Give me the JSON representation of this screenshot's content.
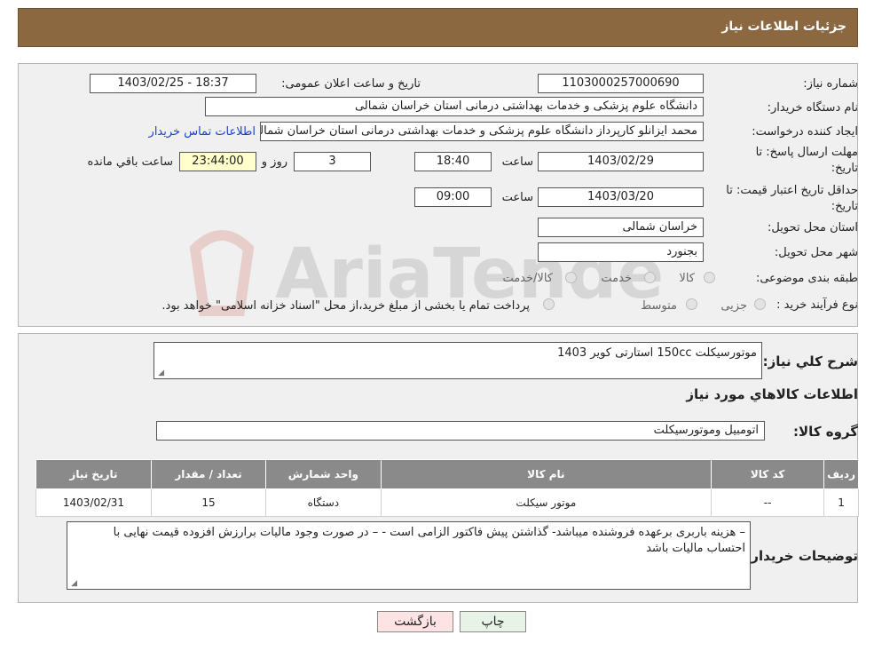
{
  "header": {
    "title": "جزئیات اطلاعات نیاز"
  },
  "details": {
    "need_number_label": "شماره نیاز:",
    "need_number": "1103000257000690",
    "announce_label": "تاریخ و ساعت اعلان عمومی:",
    "announce_value": "1403/02/25 - 18:37",
    "buyer_org_label": "نام دستگاه خریدار:",
    "buyer_org": "دانشگاه علوم پزشکی و خدمات بهداشتی درمانی استان خراسان شمالی",
    "creator_label": "ایجاد کننده درخواست:",
    "creator": "محمد ایزانلو کارپرداز دانشگاه علوم پزشکی و خدمات بهداشتی درمانی استان خراسان شمالی",
    "contact_link": "اطلاعات تماس خریدار",
    "reply_deadline_label": "مهلت ارسال پاسخ: تا",
    "reply_deadline_label2": "تاریخ:",
    "reply_date": "1403/02/29",
    "time_label": "ساعت",
    "reply_time": "18:40",
    "days_value": "3",
    "days_label": "روز و",
    "remaining_time": "23:44:00",
    "remaining_label": "ساعت باقي مانده",
    "validity_label": "حداقل تاریخ اعتبار قیمت: تا",
    "validity_label2": "تاریخ:",
    "validity_date": "1403/03/20",
    "validity_time": "09:00",
    "province_label": "استان محل تحویل:",
    "province": "خراسان شمالی",
    "city_label": "شهر محل تحویل:",
    "city": "بجنورد",
    "category_label": "طبقه بندی موضوعی:",
    "category_options": [
      "کالا",
      "خدمت",
      "کالا/خدمت"
    ],
    "process_label": "نوع فرآیند خرید :",
    "process_options": [
      "جزیی",
      "متوسط"
    ],
    "process_note": "پرداخت تمام یا بخشی از مبلغ خرید،از محل \"اسناد خزانه اسلامی\" خواهد بود."
  },
  "need_desc": {
    "label": "شرح کلي نياز:",
    "value": "موتورسیکلت 150cc استارتی   کویر 1403"
  },
  "goods_info_title": "اطلاعات کالاهاي مورد نياز",
  "goods_group": {
    "label": "گروه کالا:",
    "value": "اتومبیل وموتورسیکلت"
  },
  "table": {
    "headers": [
      "رديف",
      "کد کالا",
      "نام کالا",
      "واحد شمارش",
      "تعداد / مقدار",
      "تاریخ نیاز"
    ],
    "rows": [
      [
        "1",
        "--",
        "موتور سیکلت",
        "دستگاه",
        "15",
        "1403/02/31"
      ]
    ]
  },
  "buyer_notes": {
    "label": "توضیحات خریدار:",
    "value": "– هزینه باربری برعهده فروشنده میباشد- گذاشتن پیش فاکتور الزامی است -  – در صورت وجود مالیات برارزش افزوده قیمت نهایی با احتساب مالیات باشد"
  },
  "buttons": {
    "print": "چاپ",
    "back": "بازگشت"
  },
  "watermark": {
    "text": "AriaTender.neT"
  },
  "colors": {
    "header": "#8b6840",
    "panel": "#f0f0f0",
    "table_header": "#8a8a8a",
    "back_button": "#fde3e3",
    "link": "#1a3fcf"
  }
}
